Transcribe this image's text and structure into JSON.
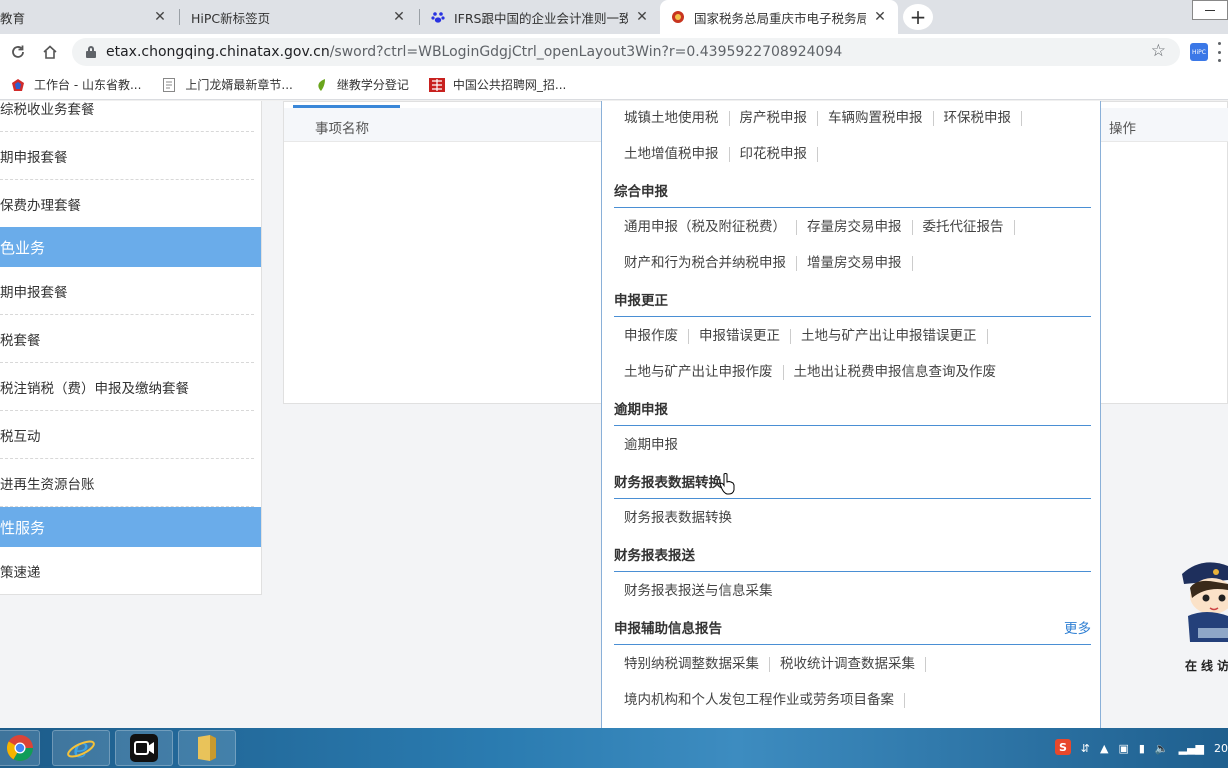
{
  "browser": {
    "tabs": [
      {
        "title": "教育",
        "active": false
      },
      {
        "title": "HiPC新标签页",
        "active": false
      },
      {
        "title": "IFRS跟中国的企业会计准则一致吗",
        "active": false
      },
      {
        "title": "国家税务总局重庆市电子税务局",
        "active": true
      }
    ],
    "new_tab": "+",
    "close_glyph": "✕",
    "url_host": "etax.chongqing.chinatax.gov.cn",
    "url_path": "/sword?ctrl=WBLoginGdgjCtrl_openLayout3Win?r=0.4395922708924094",
    "ext_label": "HiPC",
    "bookmarks": [
      {
        "label": "工作台 - 山东省教..."
      },
      {
        "label": "上门龙婿最新章节..."
      },
      {
        "label": "继教学分登记"
      },
      {
        "label": "中国公共招聘网_招..."
      }
    ]
  },
  "sidebar": {
    "items": [
      {
        "label": "综税收业务套餐",
        "type": "item"
      },
      {
        "label": "期申报套餐",
        "type": "item"
      },
      {
        "label": "保费办理套餐",
        "type": "item"
      },
      {
        "label": "色业务",
        "type": "header"
      },
      {
        "label": "期申报套餐",
        "type": "item"
      },
      {
        "label": "税套餐",
        "type": "item"
      },
      {
        "label": "税注销税（费）申报及缴纳套餐",
        "type": "item"
      },
      {
        "label": "税互动",
        "type": "item"
      },
      {
        "label": "进再生资源台账",
        "type": "item"
      },
      {
        "label": "性服务",
        "type": "header"
      },
      {
        "label": "策速递",
        "type": "item"
      }
    ]
  },
  "table": {
    "col_left": "事项名称",
    "col_right": "操作"
  },
  "dropdown": {
    "row0": [
      "城镇土地使用税",
      "房产税申报",
      "车辆购置税申报",
      "环保税申报"
    ],
    "row1": [
      "土地增值税申报",
      "印花税申报"
    ],
    "sections": [
      {
        "title": "综合申报",
        "rows": [
          [
            "通用申报（税及附征税费）",
            "存量房交易申报",
            "委托代征报告"
          ],
          [
            "财产和行为税合并纳税申报",
            "增量房交易申报"
          ]
        ]
      },
      {
        "title": "申报更正",
        "rows": [
          [
            "申报作废",
            "申报错误更正",
            "土地与矿产出让申报错误更正"
          ],
          [
            "土地与矿产出让申报作废",
            "土地出让税费申报信息查询及作废"
          ]
        ]
      },
      {
        "title": "逾期申报",
        "rows": [
          [
            "逾期申报"
          ]
        ]
      },
      {
        "title": "财务报表数据转换",
        "rows": [
          [
            "财务报表数据转换"
          ]
        ]
      },
      {
        "title": "财务报表报送",
        "rows": [
          [
            "财务报表报送与信息采集"
          ]
        ]
      },
      {
        "title": "申报辅助信息报告",
        "more": "更多",
        "rows": [
          [
            "特别纳税调整数据采集",
            "税收统计调查数据采集"
          ],
          [
            "境内机构和个人发包工程作业或劳务项目备案"
          ]
        ]
      }
    ]
  },
  "mascot": {
    "label": "在线访"
  },
  "taskbar": {
    "tray_time": "20"
  },
  "colors": {
    "accent": "#3a87d8",
    "sidebar_header": "#6aacea",
    "more_link": "#2f7fd3"
  }
}
